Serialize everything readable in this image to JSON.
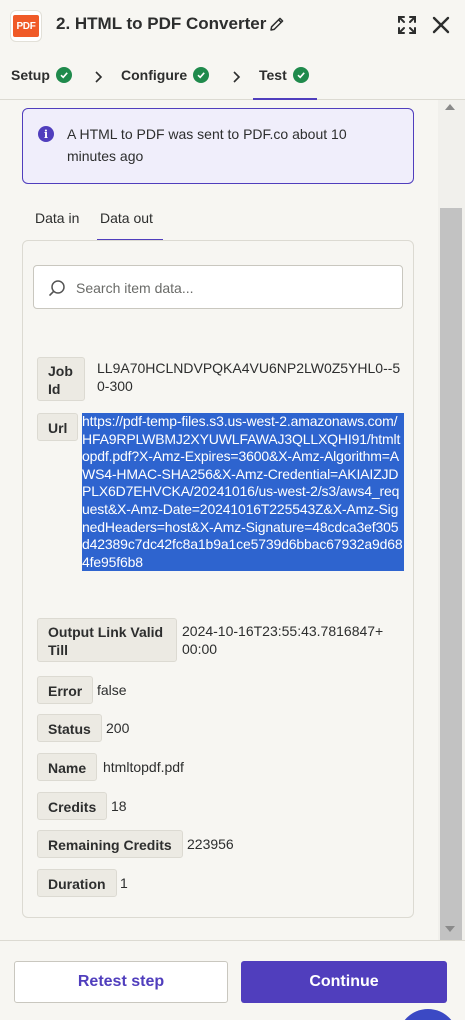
{
  "header": {
    "app_logo_text": "PDF",
    "title": "2. HTML to PDF Converter"
  },
  "steps": [
    {
      "label": "Setup",
      "done": true
    },
    {
      "label": "Configure",
      "done": true
    },
    {
      "label": "Test",
      "done": true,
      "active": true
    }
  ],
  "info": {
    "message": "A HTML to PDF was sent to PDF.co about 10 minutes ago"
  },
  "tabs": [
    {
      "label": "Data in"
    },
    {
      "label": "Data out",
      "active": true
    }
  ],
  "search": {
    "placeholder": "Search item data..."
  },
  "fields": {
    "job_id": {
      "key": "Job Id",
      "value": "LL9A70HCLNDVPQKA4VU6NP2LW0Z5YHL0--50-300"
    },
    "url": {
      "key": "Url",
      "value": "https://pdf-temp-files.s3.us-west-2.amazonaws.com/HFA9RPLWBMJ2XYUWLFAWAJ3QLLXQHI91/htmltopdf.pdf?X-Amz-Expires=3600&X-Amz-Algorithm=AWS4-HMAC-SHA256&X-Amz-Credential=AKIAIZJDPLX6D7EHVCKA/20241016/us-west-2/s3/aws4_request&X-Amz-Date=20241016T225543Z&X-Amz-SignedHeaders=host&X-Amz-Signature=48cdca3ef305d42389c7dc42fc8a1b9a1ce5739d6bbac67932a9d684fe95f6b8"
    },
    "output_link": {
      "key": "Output Link Valid Till",
      "value": "2024-10-16T23:55:43.7816847+00:00"
    },
    "error": {
      "key": "Error",
      "value": "false"
    },
    "status": {
      "key": "Status",
      "value": "200"
    },
    "name": {
      "key": "Name",
      "value": "htmltopdf.pdf"
    },
    "credits": {
      "key": "Credits",
      "value": "18"
    },
    "remaining_credits": {
      "key": "Remaining Credits",
      "value": "223956"
    },
    "duration": {
      "key": "Duration",
      "value": "1"
    }
  },
  "footer": {
    "retest_label": "Retest step",
    "continue_label": "Continue"
  },
  "colors": {
    "accent": "#503ebd",
    "success": "#1f8a4c",
    "selection": "#2e64cf",
    "brand_logo": "#f05a28"
  },
  "icons": [
    "pencil-icon",
    "expand-icon",
    "close-icon",
    "check-icon",
    "chevron-right-icon",
    "info-icon",
    "search-icon"
  ]
}
